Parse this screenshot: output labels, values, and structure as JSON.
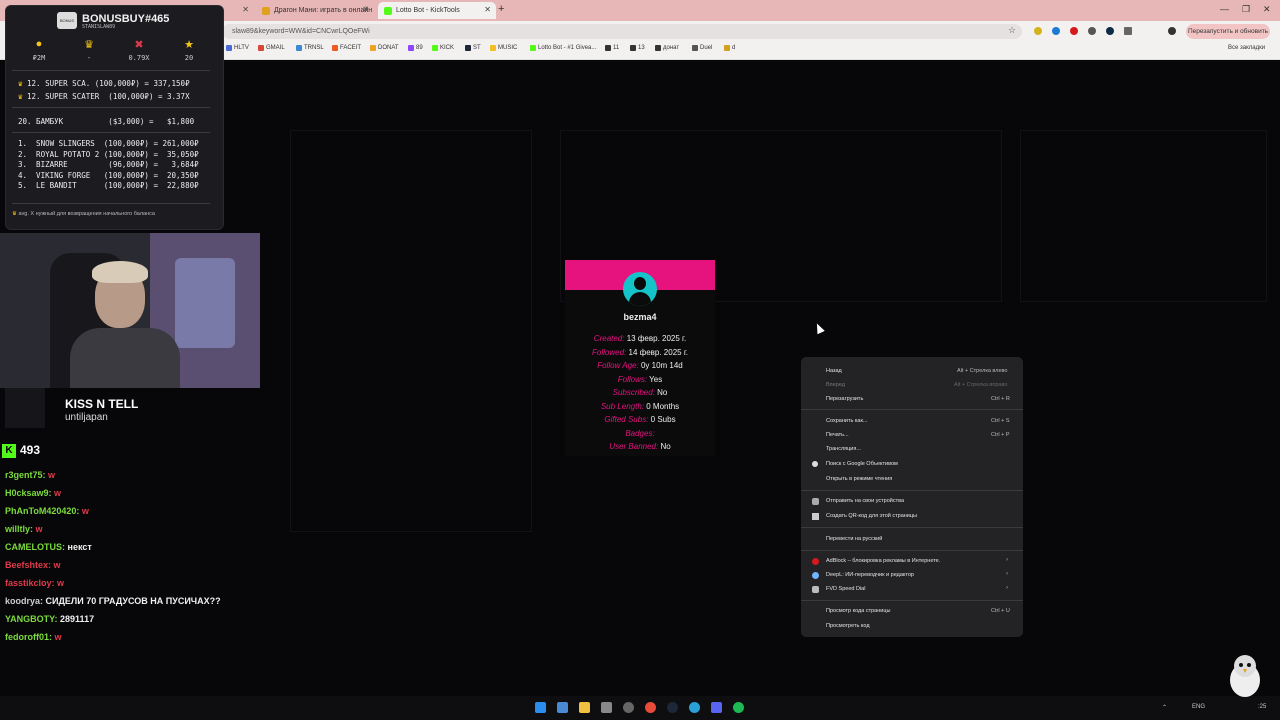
{
  "browser": {
    "tabs": [
      {
        "label": "",
        "active": false
      },
      {
        "label": "Драгон Мани: играть в онлайн",
        "active": false
      },
      {
        "label": "Lotto Bot - KickTools",
        "active": true
      }
    ],
    "address": "slaw89&keyword=WW&id=CNCwrLQOeFWi",
    "update_button": "Перезапустить и обновить",
    "all_bookmarks": "Все закладки",
    "bookmarks": [
      "HLTV",
      "GMAIL",
      "TRNSL",
      "FACEIT",
      "DONAT",
      "89",
      "KICK",
      "ST",
      "MUSIC",
      "Lotto Bot - #1 Givea...",
      "11",
      "13",
      "донат",
      "Duel",
      "d"
    ]
  },
  "profile_card": {
    "username": "bezma4",
    "header_color": "#e6137f",
    "fields": [
      {
        "label": "Created:",
        "value": "13 февр. 2025 г."
      },
      {
        "label": "Followed:",
        "value": "14 февр. 2025 г."
      },
      {
        "label": "Follow Age:",
        "value": "0y 10m 14d"
      },
      {
        "label": "Follows:",
        "value": "Yes"
      },
      {
        "label": "Subscribed:",
        "value": "No"
      },
      {
        "label": "Sub Length:",
        "value": "0 Months"
      },
      {
        "label": "Gifted Subs:",
        "value": "0 Subs"
      },
      {
        "label": "Badges:",
        "value": ""
      },
      {
        "label": "User Banned:",
        "value": "No"
      }
    ]
  },
  "context_menu": {
    "items": [
      {
        "label": "Назад",
        "shortcut": "Alt + Стрелка влево",
        "disabled": false
      },
      {
        "label": "Вперед",
        "shortcut": "Alt + Стрелка вправо",
        "disabled": true
      },
      {
        "label": "Перезагрузить",
        "shortcut": "Ctrl + R",
        "disabled": false
      },
      {
        "label": "Сохранить как...",
        "shortcut": "Ctrl + S",
        "disabled": false
      },
      {
        "label": "Печать...",
        "shortcut": "Ctrl + P",
        "disabled": false
      },
      {
        "label": "Трансляция...",
        "shortcut": "",
        "disabled": false
      },
      {
        "label": "Поиск с Google Объективом",
        "shortcut": "",
        "disabled": false
      },
      {
        "label": "Открыть в режиме чтения",
        "shortcut": "",
        "disabled": false
      },
      {
        "label": "Отправить на свои устройства",
        "shortcut": "",
        "disabled": false
      },
      {
        "label": "Создать QR-код для этой страницы",
        "shortcut": "",
        "disabled": false
      },
      {
        "label": "Перевести на русский",
        "shortcut": "",
        "disabled": false
      },
      {
        "label": "AdBlock – блокировка рекламы в Интернете.",
        "shortcut": "",
        "disabled": false
      },
      {
        "label": "DeepL: ИИ-переводчик и редактор",
        "shortcut": "",
        "disabled": false
      },
      {
        "label": "FVD Speed Dial",
        "shortcut": "",
        "disabled": false
      },
      {
        "label": "Просмотр кода страницы",
        "shortcut": "Ctrl + U",
        "disabled": false
      },
      {
        "label": "Просмотреть код",
        "shortcut": "",
        "disabled": false
      }
    ]
  },
  "bonus_buy": {
    "title": "BONUSBUY#465",
    "subtitle": "STANISLAW89",
    "logo_text": "BONUS",
    "stats": [
      {
        "icon": "coin-icon",
        "glyph": "●",
        "color": "#f5c518",
        "value": "₽2M"
      },
      {
        "icon": "crown-icon",
        "glyph": "♛",
        "color": "#f5c518",
        "value": "-"
      },
      {
        "icon": "cross-icon",
        "glyph": "✖",
        "color": "#e03a4a",
        "value": "0.79X"
      },
      {
        "icon": "star-icon",
        "glyph": "★",
        "color": "#f5c518",
        "value": "20"
      }
    ],
    "top": [
      "12. SUPER SCA. (100,000₽) = 337,150₽",
      "12. SUPER SCATER  (100,000₽) = 3.37X"
    ],
    "current": "20. БАМБУК          ($3,000) =   $1,800",
    "list": [
      "1.  SNOW SLINGERS  (100,000₽) = 261,000₽",
      "2.  ROYAL POTATO 2 (100,000₽) =  35,050₽",
      "3.  BIZARRE         (96,000₽) =   3,684₽",
      "4.  VIKING FORGE   (100,000₽) =  20,350₽",
      "5.  LE BANDIT      (100,000₽) =  22,880₽"
    ],
    "footer": "avg. X нужный для возвращения начального баланса"
  },
  "now_playing": {
    "title": "KISS N TELL",
    "artist": "untiljapan"
  },
  "viewers": {
    "badge": "K",
    "count": "493"
  },
  "chat": [
    {
      "user": "r3gent75:",
      "user_color": "#7cdb3c",
      "msg": "w",
      "msg_red": true
    },
    {
      "user": "H0cksaw9:",
      "user_color": "#7cdb3c",
      "msg": "w",
      "msg_red": true
    },
    {
      "user": "PhAnToM420420:",
      "user_color": "#7cdb3c",
      "msg": "w",
      "msg_red": true
    },
    {
      "user": "willtly:",
      "user_color": "#7cdb3c",
      "msg": "w",
      "msg_red": true
    },
    {
      "user": "CAMELOTUS:",
      "user_color": "#7cdb3c",
      "msg": "некст",
      "msg_red": false
    },
    {
      "user": "Beefshtex:",
      "user_color": "#e03a4a",
      "msg": "w",
      "msg_red": true
    },
    {
      "user": "fasstikcloy:",
      "user_color": "#e03a4a",
      "msg": "w",
      "msg_red": true
    },
    {
      "user": "koodrya:",
      "user_color": "#cfcfcf",
      "msg": "СИДЕЛИ 70 ГРАДУСОВ НА ПУСИЧАХ??",
      "msg_red": false
    },
    {
      "user": "YANGBOTY:",
      "user_color": "#7cdb3c",
      "msg": "2891117",
      "msg_red": false
    },
    {
      "user": "fedoroff01:",
      "user_color": "#7cdb3c",
      "msg": "w",
      "msg_red": true
    }
  ],
  "tray": {
    "lang": "ENG",
    "time": ":25"
  }
}
